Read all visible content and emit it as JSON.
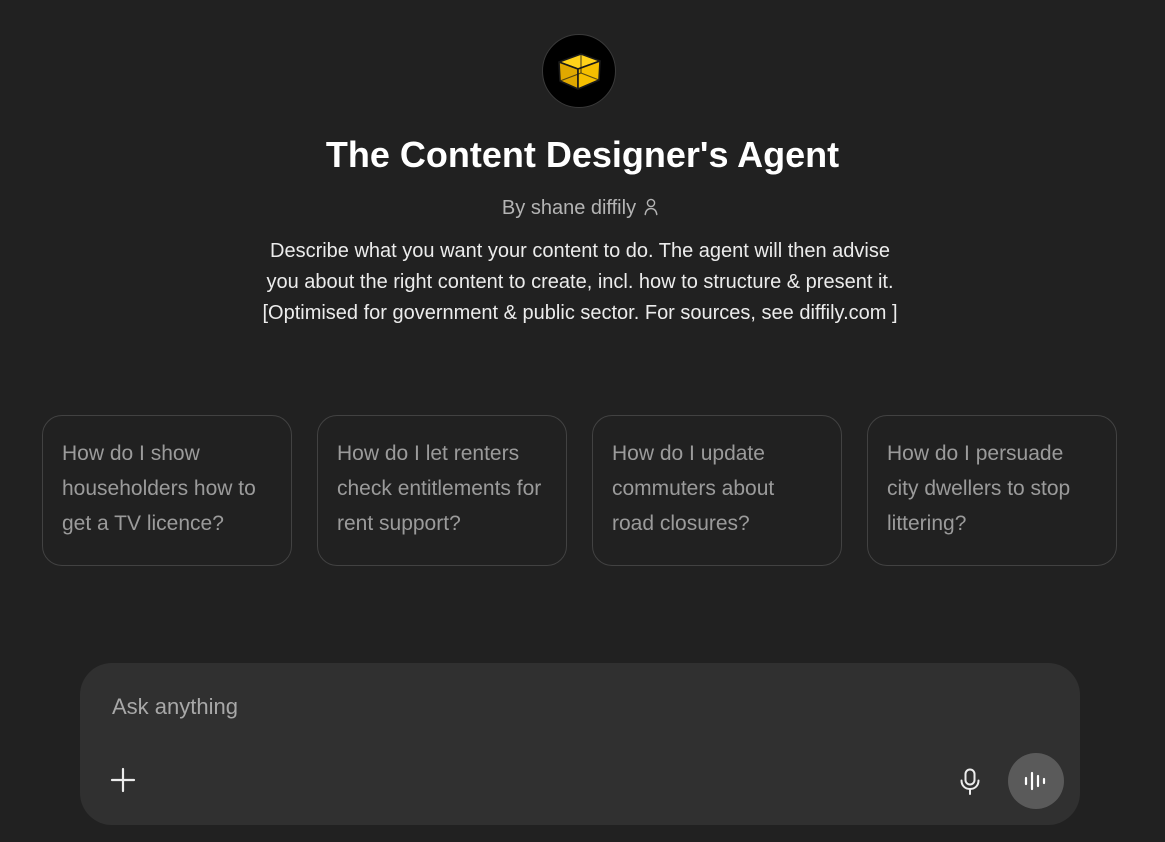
{
  "agent": {
    "avatar_icon": "yellow-cube-icon",
    "title": "The Content Designer's Agent",
    "byline": "By shane diffily",
    "byline_icon": "person-icon",
    "description": [
      "Describe what you want your content to do. The agent will then advise",
      "you about the right content to create, incl. how to structure & present it.",
      "[Optimised for government & public sector. For sources, see diffily.com ]"
    ]
  },
  "suggestions": [
    {
      "text": "How do I show householders how to get a TV licence?"
    },
    {
      "text": "How do I let renters check entitlements for rent support?"
    },
    {
      "text": "How do I update commuters about road closures?"
    },
    {
      "text": "How do I persuade city dwellers to stop littering?"
    }
  ],
  "composer": {
    "placeholder": "Ask anything",
    "value": "",
    "add_icon": "plus-icon",
    "mic_icon": "microphone-icon",
    "voice_icon": "voice-waveform-icon"
  },
  "colors": {
    "background": "#212121",
    "composer_bg": "#303030",
    "avatar_cube": "#f5c000",
    "card_border": "#424242"
  }
}
